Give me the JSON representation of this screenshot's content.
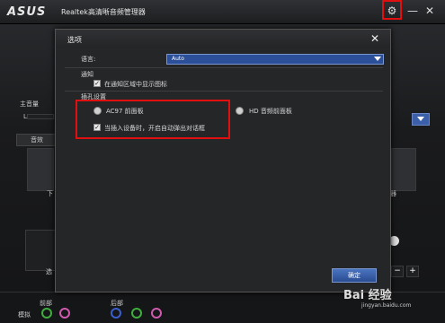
{
  "titlebar": {
    "logo": "ASUS",
    "title": "Realtek高清晰音频管理器",
    "settings_icon": "gear-icon",
    "minimize": "—",
    "close": "✕"
  },
  "background": {
    "master_volume_label": "主音量",
    "left_mark": "L",
    "tab_label": "音效",
    "speaker_label_left": "下",
    "speaker_label_right": "器",
    "bottom_left_label": "选",
    "minus": "−",
    "plus": "+",
    "front_label": "前部",
    "rear_label": "后部",
    "analog_label": "模拟"
  },
  "dialog": {
    "title": "选项",
    "close": "✕",
    "language_label": "语言:",
    "language_value": "Auto",
    "notify_heading": "通知",
    "notify_checkbox_label": "在通知区域中显示图标",
    "jack_heading": "插孔设置",
    "radio_ac97": "AC97 前面板",
    "radio_hd": "HD 音频前面板",
    "popup_checkbox_label": "当插入设备时，开启自动弹出对话框",
    "ok_button": "确定"
  },
  "watermark": {
    "text": "Bai 经验",
    "sub": "jingyan.baidu.com"
  },
  "colors": {
    "highlight": "#e01010",
    "accent_blue": "#2c4f9a"
  }
}
